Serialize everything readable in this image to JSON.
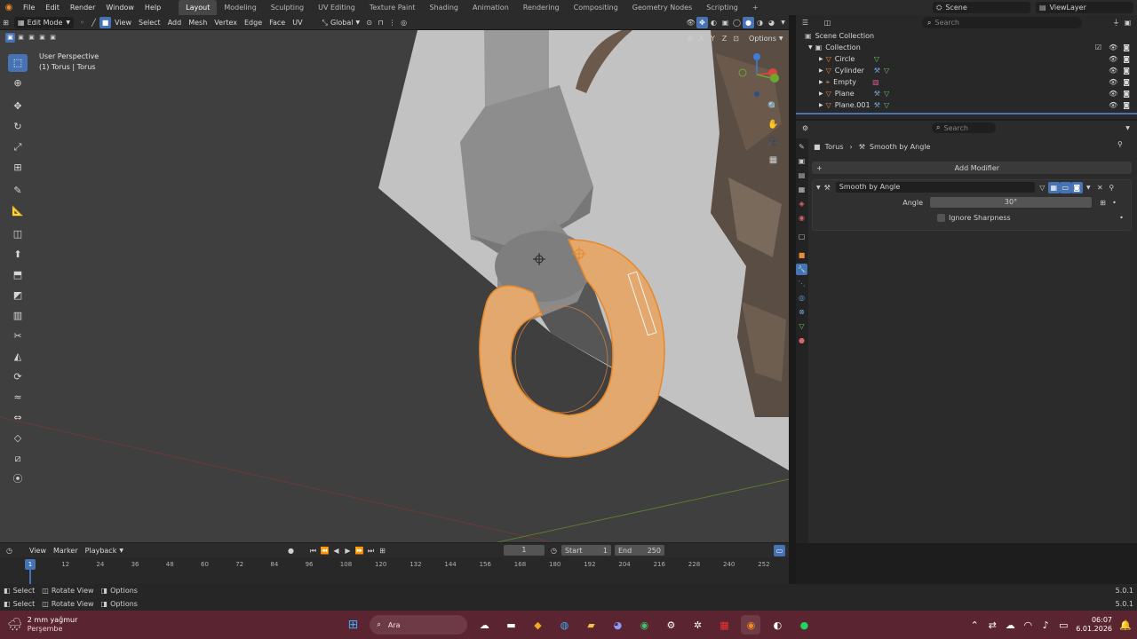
{
  "topbar": {
    "menu": [
      "File",
      "Edit",
      "Render",
      "Window",
      "Help"
    ],
    "workspaces": [
      "Layout",
      "Modeling",
      "Sculpting",
      "UV Editing",
      "Texture Paint",
      "Shading",
      "Animation",
      "Rendering",
      "Compositing",
      "Geometry Nodes",
      "Scripting"
    ],
    "active_workspace": "Layout",
    "scene": "Scene",
    "view_layer": "ViewLayer"
  },
  "viewport_header": {
    "mode": "Edit Mode",
    "menus": [
      "View",
      "Select",
      "Add",
      "Mesh",
      "Vertex",
      "Edge",
      "Face",
      "UV"
    ],
    "transform": "Global",
    "xyz": [
      "X",
      "Y",
      "Z"
    ],
    "options": "Options"
  },
  "viewport": {
    "perspective": "User Perspective",
    "object_info": "(1) Torus | Torus"
  },
  "outliner": {
    "search_placeholder": "Search",
    "scene_collection": "Scene Collection",
    "collection": "Collection",
    "items": [
      {
        "name": "Circle"
      },
      {
        "name": "Cylinder"
      },
      {
        "name": "Empty"
      },
      {
        "name": "Plane"
      },
      {
        "name": "Plane.001"
      }
    ]
  },
  "properties": {
    "search_placeholder": "Search",
    "breadcrumb_object": "Torus",
    "breadcrumb_modifier": "Smooth by Angle",
    "add_modifier": "Add Modifier",
    "modifier_name": "Smooth by Angle",
    "angle_label": "Angle",
    "angle_value": "30°",
    "ignore_sharpness": "Ignore Sharpness"
  },
  "timeline": {
    "menus": [
      "View",
      "Marker",
      "Playback"
    ],
    "current_frame": "1",
    "start_label": "Start",
    "start_value": "1",
    "end_label": "End",
    "end_value": "250",
    "ticks": [
      "12",
      "24",
      "36",
      "48",
      "60",
      "72",
      "84",
      "96",
      "108",
      "120",
      "132",
      "144",
      "156",
      "168",
      "180",
      "192",
      "204",
      "216",
      "228",
      "240",
      "252"
    ],
    "playhead": "1"
  },
  "status": {
    "row1": [
      "Select",
      "Rotate View",
      "Options"
    ],
    "row2": [
      "Select",
      "Rotate View",
      "Options"
    ],
    "version1": "5.0.1",
    "version2": "5.0.1"
  },
  "taskbar": {
    "weather_temp": "2 mm yağmur",
    "weather_day": "Perşembe",
    "search": "Ara",
    "time": "06:07",
    "date": "6.01.2026"
  },
  "colors": {
    "accent": "#4772b3",
    "selection": "#e8882a",
    "torus": "#e3a86d",
    "taskbar": "#5a2430"
  }
}
